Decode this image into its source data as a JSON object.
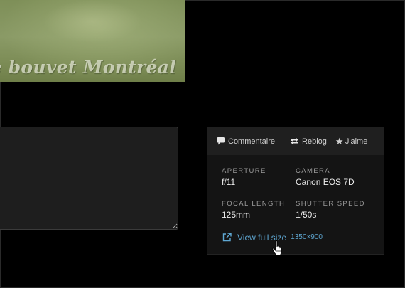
{
  "photo": {
    "watermark": "nique bouvet Montréal"
  },
  "comment_box": {
    "value": ""
  },
  "actions": {
    "comment": "Commentaire",
    "reblog": "Reblog",
    "like": "J'aime"
  },
  "exif": {
    "aperture_label": "APERTURE",
    "aperture_value": "f/11",
    "camera_label": "CAMERA",
    "camera_value": "Canon EOS 7D",
    "focal_label": "FOCAL LENGTH",
    "focal_value": "125mm",
    "shutter_label": "SHUTTER SPEED",
    "shutter_value": "1/50s"
  },
  "view_full_size": {
    "label": "View full size",
    "dimensions": "1350×900"
  },
  "icons": {
    "comment": "speech-bubble-icon",
    "reblog": "reblog-arrows-icon",
    "like": "star-icon",
    "external": "external-link-icon",
    "cursor": "hand-pointer-cursor"
  },
  "colors": {
    "background": "#000000",
    "panel": "#141414",
    "action_bar": "#1f1f1f",
    "link": "#5fa8d3"
  }
}
